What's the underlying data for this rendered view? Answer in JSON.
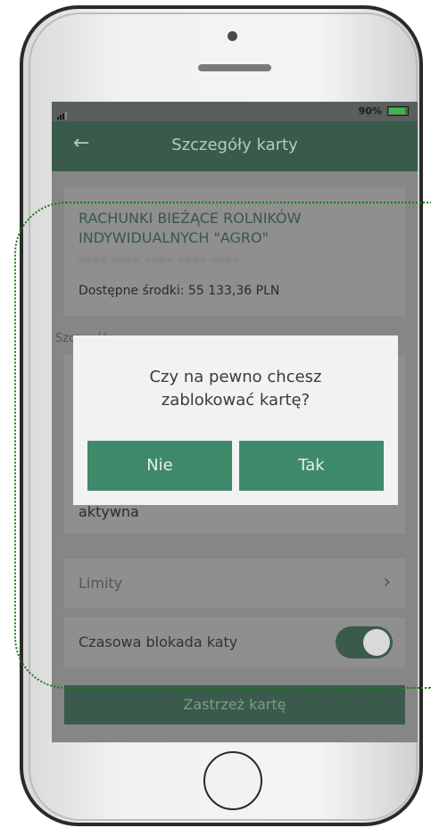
{
  "status_bar": {
    "battery_percent": "90%",
    "battery_level": 0.9,
    "accent_color": "#3bb84a"
  },
  "header": {
    "title": "Szczegóły karty",
    "back_icon": "back-arrow-icon"
  },
  "account": {
    "name": "RACHUNKI BIEŻĄCE ROLNIKÓW INDYWIDUALNYCH \"AGRO\"",
    "funds": "Dostępne środki: 55 133,36 PLN"
  },
  "details": {
    "section_label": "Szczegóły",
    "card_status": "aktywna"
  },
  "limits": {
    "label": "Limity"
  },
  "block": {
    "label": "Czasowa blokada katy",
    "toggle_on": true
  },
  "reserve_button": {
    "label": "Zastrzeż kartę"
  },
  "modal": {
    "message_line1": "Czy na pewno chcesz",
    "message_line2": "zablokować kartę?",
    "no_label": "Nie",
    "yes_label": "Tak"
  },
  "colors": {
    "brand_green": "#3a5b4b",
    "button_green": "#3e8a6a",
    "highlight": "#1c7a1c"
  }
}
